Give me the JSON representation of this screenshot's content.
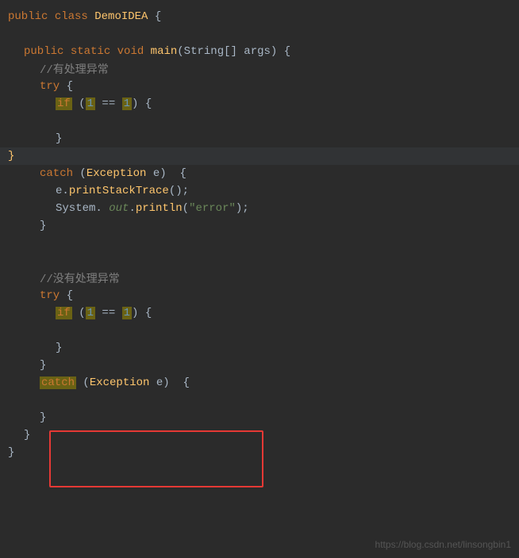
{
  "code": {
    "lines": [
      {
        "id": 1,
        "content": "public class DemoIDEA {",
        "type": "class-decl"
      },
      {
        "id": 2,
        "content": "",
        "type": "blank"
      },
      {
        "id": 3,
        "content": "    public static void main(String[] args) {",
        "type": "method-decl"
      },
      {
        "id": 4,
        "content": "        //有处理异常",
        "type": "comment"
      },
      {
        "id": 5,
        "content": "        try {",
        "type": "try"
      },
      {
        "id": 6,
        "content": "            if (1 == 1) {",
        "type": "if"
      },
      {
        "id": 7,
        "content": "",
        "type": "blank"
      },
      {
        "id": 8,
        "content": "            }",
        "type": "brace"
      },
      {
        "id": 9,
        "content": "        }",
        "type": "brace-highlighted"
      },
      {
        "id": 10,
        "content": "        catch (Exception e)  {",
        "type": "catch"
      },
      {
        "id": 11,
        "content": "            e.printStackTrace();",
        "type": "normal"
      },
      {
        "id": 12,
        "content": "            System. out.println(\"error\");",
        "type": "println"
      },
      {
        "id": 13,
        "content": "        }",
        "type": "brace"
      },
      {
        "id": 14,
        "content": "",
        "type": "blank"
      },
      {
        "id": 15,
        "content": "",
        "type": "blank"
      },
      {
        "id": 16,
        "content": "        //没有处理异常",
        "type": "comment"
      },
      {
        "id": 17,
        "content": "        try {",
        "type": "try"
      },
      {
        "id": 18,
        "content": "            if (1 == 1) {",
        "type": "if"
      },
      {
        "id": 19,
        "content": "",
        "type": "blank"
      },
      {
        "id": 20,
        "content": "            }",
        "type": "brace"
      },
      {
        "id": 21,
        "content": "        }",
        "type": "brace"
      },
      {
        "id": 22,
        "content": "        catch (Exception e)  {",
        "type": "catch-highlighted"
      },
      {
        "id": 23,
        "content": "",
        "type": "blank"
      },
      {
        "id": 24,
        "content": "        }",
        "type": "brace"
      },
      {
        "id": 25,
        "content": "    }",
        "type": "brace"
      },
      {
        "id": 26,
        "content": "}",
        "type": "brace"
      }
    ],
    "watermark": "https://blog.csdn.net/linsongbin1"
  }
}
